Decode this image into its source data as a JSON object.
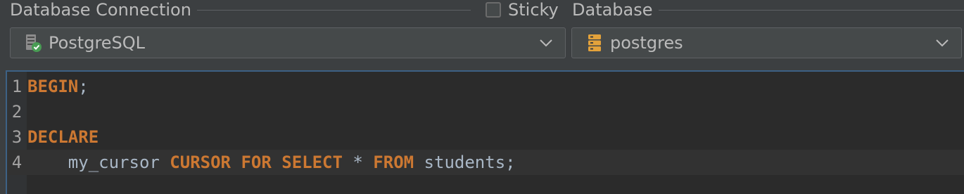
{
  "header": {
    "connection_title": "Database Connection",
    "sticky_label": "Sticky",
    "database_title": "Database"
  },
  "connection": {
    "selected": "PostgreSQL",
    "icon": "database-connected-icon"
  },
  "database": {
    "selected": "postgres",
    "icon": "database-icon"
  },
  "editor": {
    "lines": [
      {
        "number": "1",
        "tokens": [
          {
            "text": "BEGIN",
            "kind": "keyword"
          },
          {
            "text": ";",
            "kind": "plain"
          }
        ]
      },
      {
        "number": "2",
        "tokens": []
      },
      {
        "number": "3",
        "tokens": [
          {
            "text": "DECLARE",
            "kind": "keyword"
          }
        ]
      },
      {
        "number": "4",
        "tokens": [
          {
            "text": "    my_cursor ",
            "kind": "plain"
          },
          {
            "text": "CURSOR FOR SELECT",
            "kind": "keyword"
          },
          {
            "text": " * ",
            "kind": "plain"
          },
          {
            "text": "FROM",
            "kind": "keyword"
          },
          {
            "text": " students;",
            "kind": "plain"
          }
        ]
      }
    ]
  },
  "colors": {
    "keyword": "#cc7832",
    "plain": "#a9b7c6",
    "focus_border": "#3d6185",
    "editor_bg": "#2b2b2b"
  }
}
